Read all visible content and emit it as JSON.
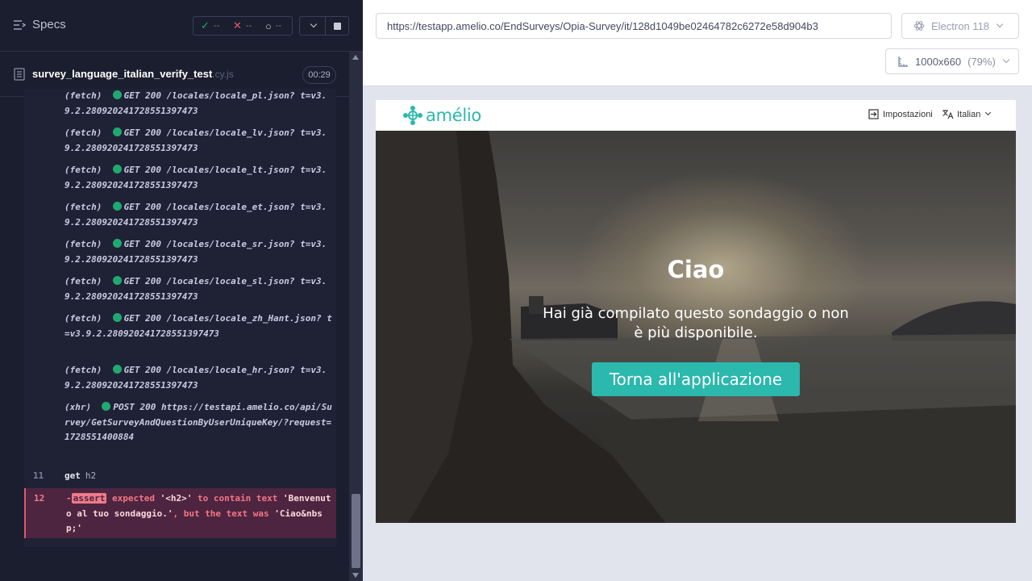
{
  "runner": {
    "specs_label": "Specs",
    "stats": {
      "passed_icon": "✓",
      "passed": "--",
      "failed_icon": "✕",
      "failed": "--",
      "pending_icon": "○",
      "pending": "--"
    },
    "spec": {
      "name": "survey_language_italian_verify_test",
      "ext": ".cy.js",
      "duration": "00:29"
    }
  },
  "log": {
    "entries": [
      {
        "type": "(fetch)",
        "method": "GET",
        "status": "200",
        "path": "/locales/locale_pl.json?",
        "query": "t=v3.9.2.2809202417285513974​73"
      },
      {
        "type": "(fetch)",
        "method": "GET",
        "status": "200",
        "path": "/locales/locale_lv.json?",
        "query": "t=v3.9.2.280920241728551397473"
      },
      {
        "type": "(fetch)",
        "method": "GET",
        "status": "200",
        "path": "/locales/locale_lt.json?",
        "query": "t=v3.9.2.280920241728551397473"
      },
      {
        "type": "(fetch)",
        "method": "GET",
        "status": "200",
        "path": "/locales/locale_et.json?",
        "query": "t=v3.9.2.280920241728551397473"
      },
      {
        "type": "(fetch)",
        "method": "GET",
        "status": "200",
        "path": "/locales/locale_sr.json?",
        "query": "t=v3.9.2.280920241728551397473"
      },
      {
        "type": "(fetch)",
        "method": "GET",
        "status": "200",
        "path": "/locales/locale_sl.json?",
        "query": "t=v3.9.2.280920241728551397473"
      },
      {
        "type": "(fetch)",
        "method": "GET",
        "status": "200",
        "path": "/locales/locale_zh_Hant.json?",
        "query": "t=v3.9.2.280920241728551397473"
      },
      {
        "type": "(fetch)",
        "method": "GET",
        "status": "200",
        "path": "/locales/locale_hr.json?",
        "query": "t=v3.9.2.280920241728551397473"
      },
      {
        "type": "(xhr)",
        "method": "POST",
        "status": "200",
        "path": "https://testapi.amelio.co/api/Survey/GetSurveyAndQuestionByUserUniqueKey/?request=1728551400884",
        "query": ""
      }
    ],
    "get_cmd": {
      "num": "11",
      "name": "get",
      "arg": "h2"
    },
    "assert_cmd": {
      "num": "12",
      "prefix": "-",
      "keyword": "assert",
      "part1": " expected ",
      "subject": "'<h2>'",
      "part2": " to contain text ",
      "expected": "'Benvenuto al tuo sondaggio.'",
      "part3": ", but the text was ",
      "actual": "'Ciao&nbsp;'"
    }
  },
  "browser": {
    "url": "https://testapp.amelio.co/EndSurveys/Opia-Survey/it/128d1049be02464782c6272e58d904b3",
    "browser_label": "Electron 118",
    "viewport": "1000x660",
    "viewport_pct": "(79%)"
  },
  "app": {
    "logo_text": "amélio",
    "settings_label": "Impostazioni",
    "language_label": "Italian",
    "hero_title": "Ciao",
    "hero_message": "Hai già compilato questo sondaggio o non è più disponibile.",
    "back_button": "Torna all'applicazione",
    "brand_color": "#2bb8ad"
  }
}
